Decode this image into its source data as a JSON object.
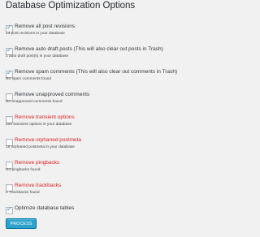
{
  "title": "Database Optimization Options",
  "options": [
    {
      "label": "Remove all post revisions",
      "desc": "13 post revisions in your database",
      "checked": true,
      "red": false
    },
    {
      "label": "Remove auto draft posts (This will also clear out posts in Trash)",
      "desc": "1 auto draft post(s) in your database",
      "checked": true,
      "red": false
    },
    {
      "label": "Remove spam comments (This will also clear out comments in Trash)",
      "desc": "No spam comments found",
      "checked": true,
      "red": false
    },
    {
      "label": "Remove unapproved comments",
      "desc": "No unapproved comments found",
      "checked": false,
      "red": false
    },
    {
      "label": "Remove transient options",
      "desc": "200 transient options in your database",
      "checked": false,
      "red": true
    },
    {
      "label": "Remove orphaned postmeta",
      "desc": "18 orphaned postmeta in your database",
      "checked": false,
      "red": true
    },
    {
      "label": "Remove pingbacks",
      "desc": "No pingbacks found",
      "checked": false,
      "red": true
    },
    {
      "label": "Remove trackbacks",
      "desc": "2 Trackbacks found",
      "checked": false,
      "red": true
    }
  ],
  "optimize": {
    "label": "Optimize database tables",
    "checked": true
  },
  "process_button": "PROCESS",
  "colors": {
    "accent": "#2ea2cc",
    "warning": "#dd2222"
  }
}
